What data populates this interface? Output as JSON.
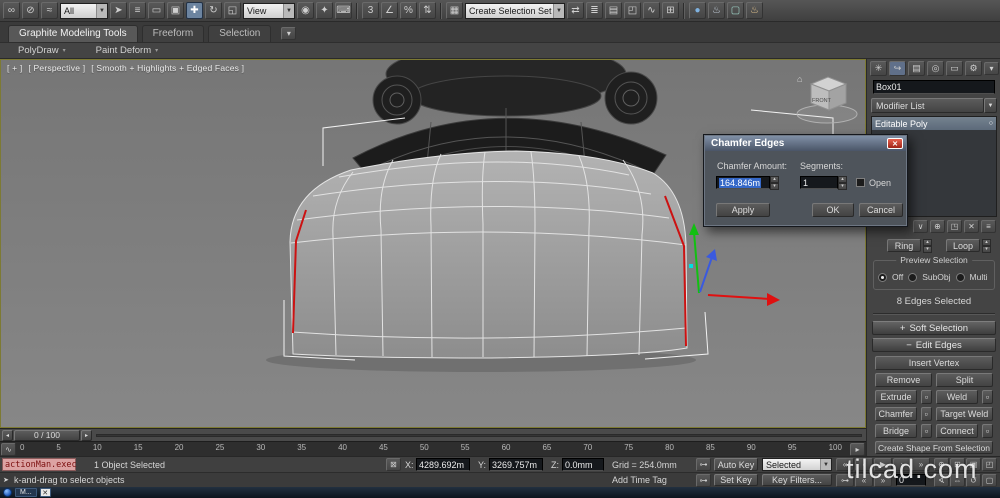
{
  "ui": {
    "up": "▴",
    "down": "▾",
    "left": "◂",
    "right": "▸",
    "close": "✕",
    "combo": "▼",
    "box": "▫",
    "bulb": "○",
    "key": "⊶",
    "lock": "⊠",
    "curve": "∿",
    "home": "⌂",
    "menu": "▾",
    "plus": "+",
    "minus": "−",
    "prompt_arrow": "➤",
    "stack_mark": "▪"
  },
  "toolbar": {
    "filter_combo": "All",
    "coord_combo": "View",
    "selset_combo": "Create Selection Set",
    "link_icons": [
      {
        "name": "select-and-link-icon",
        "glyph": "∞"
      },
      {
        "name": "unlink-selection-icon",
        "glyph": "⊘"
      },
      {
        "name": "bind-to-space-warp-icon",
        "glyph": "≈"
      }
    ],
    "select_icons": [
      {
        "name": "select-object-icon",
        "glyph": "➤"
      },
      {
        "name": "select-by-name-icon",
        "glyph": "≡"
      },
      {
        "name": "selection-region-icon",
        "glyph": "▭"
      },
      {
        "name": "window-crossing-icon",
        "glyph": "▣"
      }
    ],
    "transform_icons": [
      {
        "name": "select-and-move-icon",
        "glyph": "✚",
        "cls": "pressed"
      },
      {
        "name": "select-and-rotate-icon",
        "glyph": "↻"
      },
      {
        "name": "select-and-scale-icon",
        "glyph": "◱"
      }
    ],
    "pivot_icons": [
      {
        "name": "use-pivot-center-icon",
        "glyph": "◉"
      },
      {
        "name": "select-and-manipulate-icon",
        "glyph": "✦"
      },
      {
        "name": "keyboard-override-icon",
        "glyph": "⌨"
      }
    ],
    "snap_icons": [
      {
        "name": "snaps-toggle-icon",
        "glyph": "3"
      },
      {
        "name": "angle-snap-icon",
        "glyph": "∠"
      },
      {
        "name": "percent-snap-icon",
        "glyph": "%"
      },
      {
        "name": "spinner-snap-icon",
        "glyph": "⇅"
      }
    ],
    "set_icons": [
      {
        "name": "edit-named-sets-icon",
        "glyph": "▦"
      }
    ],
    "util_icons": [
      {
        "name": "mirror-icon",
        "glyph": "⇄"
      },
      {
        "name": "align-icon",
        "glyph": "≣"
      },
      {
        "name": "layer-manager-icon",
        "glyph": "▤"
      },
      {
        "name": "graphite-ribbon-toggle-icon",
        "glyph": "◰"
      },
      {
        "name": "curve-editor-icon",
        "glyph": "∿"
      },
      {
        "name": "schematic-view-icon",
        "glyph": "⊞"
      }
    ],
    "render_icons": [
      {
        "name": "material-editor-icon",
        "glyph": "●",
        "color": "#7fb2e0"
      },
      {
        "name": "render-setup-icon",
        "glyph": "♨",
        "color": "#c8d4e0"
      },
      {
        "name": "rendered-frame-icon",
        "glyph": "▢",
        "color": "#9fd4c8"
      },
      {
        "name": "render-production-icon",
        "glyph": "♨",
        "color": "#e8c890"
      }
    ]
  },
  "ribbon": {
    "tab_graphite": "Graphite Modeling Tools",
    "tab_freeform": "Freeform",
    "tab_selection": "Selection",
    "panel_polydraw": "PolyDraw",
    "panel_paint_deform": "Paint Deform"
  },
  "viewport": {
    "menu_general": "[ + ]",
    "menu_pov": "[ Perspective ]",
    "menu_shading": "[ Smooth + Highlights + Edged Faces ]",
    "viewcube_face": "FRONT"
  },
  "dialog": {
    "title": "Chamfer Edges",
    "amount_label": "Chamfer Amount:",
    "amount_value": "164.846m",
    "segments_label": "Segments:",
    "segments_value": "1",
    "open_label": "Open",
    "apply": "Apply",
    "ok": "OK",
    "cancel": "Cancel"
  },
  "panel": {
    "tabs": [
      {
        "name": "create-tab-icon",
        "glyph": "✳"
      },
      {
        "name": "modify-tab-icon",
        "glyph": "↪",
        "cls": "active"
      },
      {
        "name": "hierarchy-tab-icon",
        "glyph": "▤"
      },
      {
        "name": "motion-tab-icon",
        "glyph": "◎"
      },
      {
        "name": "display-tab-icon",
        "glyph": "▭"
      },
      {
        "name": "utilities-tab-icon",
        "glyph": "⚙"
      }
    ],
    "object_name": "Box01",
    "modifier_list_label": "Modifier List",
    "stack_item": "Editable Poly",
    "stack_tools": [
      {
        "name": "pin-stack-icon",
        "glyph": "∨"
      },
      {
        "name": "show-end-result-icon",
        "glyph": "⊕"
      },
      {
        "name": "make-unique-icon",
        "glyph": "◳"
      },
      {
        "name": "remove-modifier-icon",
        "glyph": "✕"
      },
      {
        "name": "configure-modifier-sets-icon",
        "glyph": "≡"
      }
    ],
    "ring_label": "Ring",
    "loop_label": "Loop",
    "preview_title": "Preview Selection",
    "opt_off": "Off",
    "opt_subobj": "SubObj",
    "opt_multi": "Multi",
    "selection_readout": "8 Edges Selected",
    "soft_selection_label": "Soft Selection",
    "edit_edges_label": "Edit Edges",
    "insert_vertex": "Insert Vertex",
    "remove": "Remove",
    "split": "Split",
    "extrude": "Extrude",
    "weld": "Weld",
    "chamfer": "Chamfer",
    "target_weld": "Target Weld",
    "bridge": "Bridge",
    "connect": "Connect",
    "create_shape": "Create Shape From Selection"
  },
  "timeline": {
    "slider_label": "0 / 100",
    "ticks": [
      "0",
      "5",
      "10",
      "15",
      "20",
      "25",
      "30",
      "35",
      "40",
      "45",
      "50",
      "55",
      "60",
      "65",
      "70",
      "75",
      "80",
      "85",
      "90",
      "95",
      "100"
    ]
  },
  "status": {
    "listener": "actionMan.exec",
    "selected_count": "1 Object Selected",
    "x_label": "X:",
    "x_value": "4289.692m",
    "y_label": "Y:",
    "y_value": "3269.757m",
    "z_label": "Z:",
    "z_value": "0.0mm",
    "grid": "Grid = 254.0mm",
    "prompt": "k-and-drag to select objects",
    "add_time_tag": "Add Time Tag",
    "auto_key": "Auto Key",
    "set_key": "Set Key",
    "selected_combo": "Selected",
    "key_filters": "Key Filters...",
    "frame_value": "0",
    "transport1": [
      {
        "name": "go-to-start-button",
        "glyph": "«"
      },
      {
        "name": "previous-frame-button",
        "glyph": "‹"
      },
      {
        "name": "play-button",
        "glyph": "▶"
      },
      {
        "name": "next-frame-button",
        "glyph": "›"
      },
      {
        "name": "go-to-end-button",
        "glyph": "»"
      }
    ],
    "transport2": [
      {
        "name": "key-mode-toggle",
        "glyph": "⊶"
      },
      {
        "name": "previous-key-button",
        "glyph": "«"
      },
      {
        "name": "next-key-button",
        "glyph": "»"
      }
    ],
    "nav1": [
      {
        "name": "zoom-icon",
        "glyph": "⊕"
      },
      {
        "name": "zoom-all-icon",
        "glyph": "⊞"
      },
      {
        "name": "zoom-extents-icon",
        "glyph": "▣"
      },
      {
        "name": "zoom-region-icon",
        "glyph": "◰"
      }
    ],
    "nav2": [
      {
        "name": "field-of-view-icon",
        "glyph": "∢"
      },
      {
        "name": "pan-icon",
        "glyph": "⇔"
      },
      {
        "name": "orbit-icon",
        "glyph": "↺"
      },
      {
        "name": "maximize-viewport-icon",
        "glyph": "▢"
      }
    ]
  },
  "taskbar": {
    "app_label": "M..."
  },
  "watermark": "tilcad.com"
}
